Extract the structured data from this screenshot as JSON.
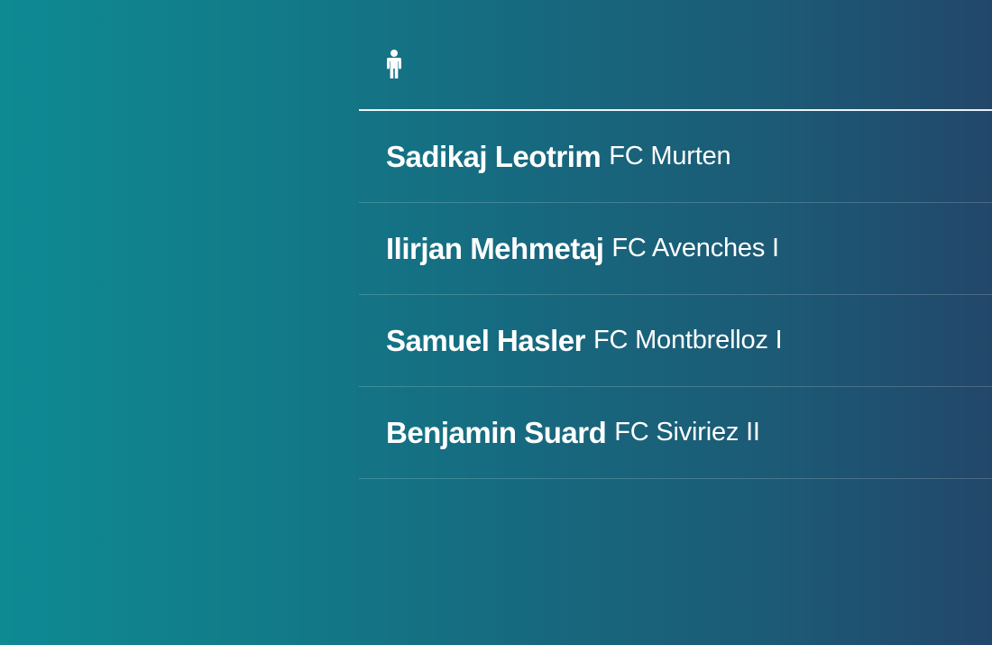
{
  "header": {
    "icon": "person-icon"
  },
  "players": [
    {
      "name": "Sadikaj Leotrim",
      "club": "FC Murten"
    },
    {
      "name": "Ilirjan Mehmetaj",
      "club": "FC Avenches I"
    },
    {
      "name": "Samuel Hasler",
      "club": "FC Montbrelloz I"
    },
    {
      "name": "Benjamin Suard",
      "club": "FC Siviriez II"
    }
  ],
  "colors": {
    "gradient_left": "#0e8a93",
    "gradient_right": "#22476a",
    "text": "#ffffff"
  }
}
